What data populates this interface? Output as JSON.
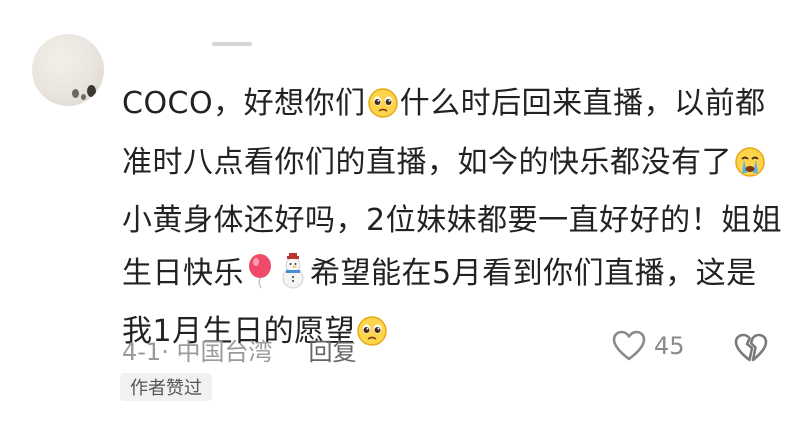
{
  "comment": {
    "lines": [
      [
        "COCO，好想你们",
        "什么时后回来直播，以前都"
      ],
      [
        "准时八点看你们的直播，如今的快乐都没有了",
        ""
      ],
      [
        "小黄身体还好吗，2位妹妹都要一直好好的！姐姐",
        ""
      ],
      [
        "生日快乐",
        "希望能在5月看到你们直播，这是"
      ],
      [
        "我1月生日的愿望",
        ""
      ]
    ]
  },
  "meta": {
    "date_location": "4-1· 中国台湾",
    "reply_label": "回复"
  },
  "likes": {
    "count": "45"
  },
  "badge": {
    "label": "作者赞过"
  },
  "icons": {
    "avatar": "avatar-image",
    "pleading": "pleading-face-icon",
    "crying": "crying-face-icon",
    "balloon": "balloon-icon",
    "snowman": "snowman-icon",
    "like": "heart-outline-icon",
    "dislike": "broken-heart-icon"
  }
}
